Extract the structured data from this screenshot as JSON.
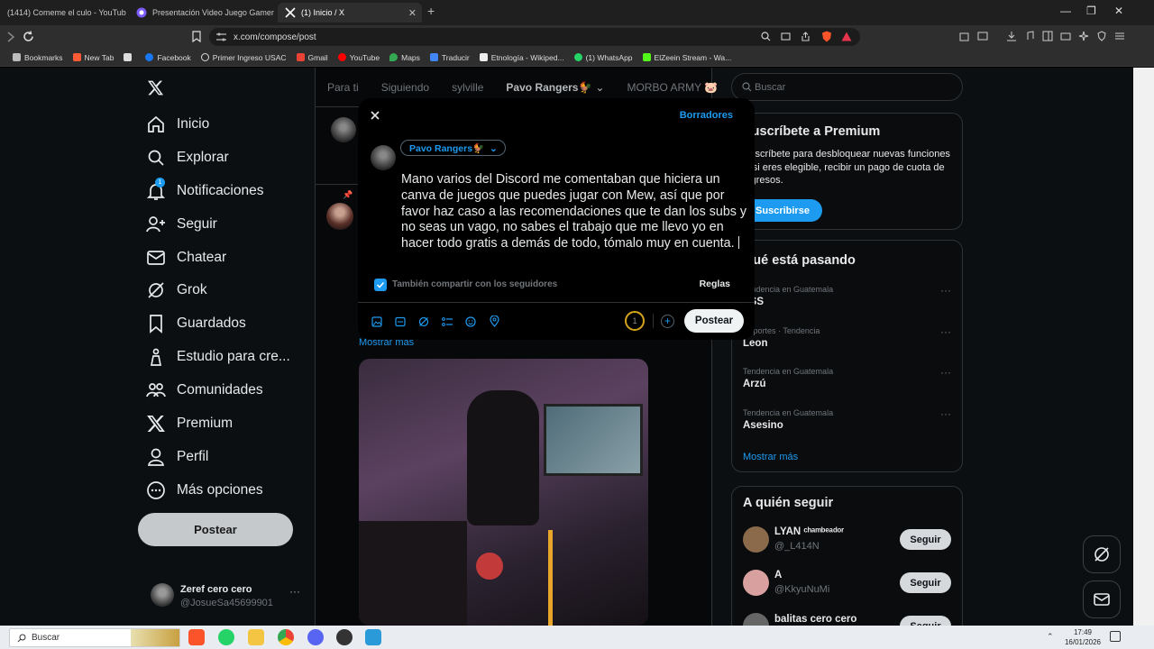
{
  "browser": {
    "tabs": [
      {
        "title": "(1414) Comeme el culo - YouTube",
        "color": "#ff0000"
      },
      {
        "title": "Presentación Video Juego Gamer Vid",
        "color": "#7c5cff"
      },
      {
        "title": "(1) Inicio / X",
        "color": "#ffffff"
      }
    ],
    "url": "x.com/compose/post",
    "bookmarks": [
      {
        "label": "Bookmarks",
        "color": "#bbbbbb"
      },
      {
        "label": "New Tab",
        "color": "#ff5a36"
      },
      {
        "label": "",
        "color": "#dddddd"
      },
      {
        "label": "Facebook",
        "color": "#1877f2"
      },
      {
        "label": "Primer Ingreso USAC",
        "color": "#dddddd"
      },
      {
        "label": "Gmail",
        "color": "#ea4335"
      },
      {
        "label": "YouTube",
        "color": "#ff0000"
      },
      {
        "label": "Maps",
        "color": "#34a853"
      },
      {
        "label": "Traducir",
        "color": "#4285f4"
      },
      {
        "label": "Etnología - Wikiped...",
        "color": "#eeeeee"
      },
      {
        "label": "(1) WhatsApp",
        "color": "#25d366"
      },
      {
        "label": "ElZeein Stream - Wa...",
        "color": "#53fc18"
      }
    ]
  },
  "nav": {
    "items": [
      {
        "label": "Inicio",
        "icon": "home-icon"
      },
      {
        "label": "Explorar",
        "icon": "search-icon"
      },
      {
        "label": "Notificaciones",
        "icon": "bell-icon",
        "badge": "1"
      },
      {
        "label": "Seguir",
        "icon": "person-plus-icon"
      },
      {
        "label": "Chatear",
        "icon": "mail-icon"
      },
      {
        "label": "Grok",
        "icon": "grok-icon"
      },
      {
        "label": "Guardados",
        "icon": "bookmark-icon"
      },
      {
        "label": "Estudio para cre...",
        "icon": "studio-icon"
      },
      {
        "label": "Comunidades",
        "icon": "communities-icon"
      },
      {
        "label": "Premium",
        "icon": "x-logo-icon"
      },
      {
        "label": "Perfil",
        "icon": "person-icon"
      },
      {
        "label": "Más opciones",
        "icon": "more-circle-icon"
      }
    ],
    "post_button": "Postear",
    "account_name": "Zeref cero cero",
    "account_handle": "@JosueSa45699901"
  },
  "timeline": {
    "tabs": [
      "Para ti",
      "Siguiendo",
      "sylville",
      "Pavo Rangers🐓",
      "MORBO ARMY 🐷"
    ],
    "show_more": "Mostrar más"
  },
  "compose": {
    "drafts": "Borradores",
    "audience": "Pavo Rangers🐓",
    "text": "Mano varios del Discord me comentaban que hiciera un canva de juegos que puedes jugar con Mew, así que por favor haz caso a las recomendaciones que te dan los subs y no seas un vago, no sabes el trabajo que me llevo yo en hacer todo gratis a demás de todo, tómalo muy en cuenta.",
    "share_label": "También compartir con los seguidores",
    "share_checked": true,
    "rules": "Reglas",
    "char_counter": "1",
    "submit": "Postear"
  },
  "sidebar": {
    "search_placeholder": "Buscar",
    "premium": {
      "title": "Suscríbete a Premium",
      "body": "Suscríbete para desbloquear nuevas funciones y, si eres elegible, recibir un pago de cuota de ingresos.",
      "button": "Suscribirse"
    },
    "trends_title": "Qué está pasando",
    "trends": [
      {
        "context": "Tendencia en Guatemala",
        "name": "ESS"
      },
      {
        "context": "Deportes · Tendencia",
        "name": "Leon"
      },
      {
        "context": "Tendencia en Guatemala",
        "name": "Arzú"
      },
      {
        "context": "Tendencia en Guatemala",
        "name": "Asesino"
      }
    ],
    "trends_more": "Mostrar más",
    "follow_title": "A quién seguir",
    "suggestions": [
      {
        "name": "LYAN ᶜʰᵃᵐᵇᵉᵃᵈᵒʳ",
        "handle": "@_L414N",
        "button": "Seguir",
        "color": "#8a6a4a"
      },
      {
        "name": "A",
        "handle": "@KkyuNuMi",
        "button": "Seguir",
        "color": "#d9a0a0"
      },
      {
        "name": "balitas cero cero",
        "handle": "",
        "button": "Seguir",
        "color": "#666666"
      }
    ]
  },
  "taskbar": {
    "search": "Buscar",
    "time": "17:49",
    "date": "16/01/2026"
  }
}
